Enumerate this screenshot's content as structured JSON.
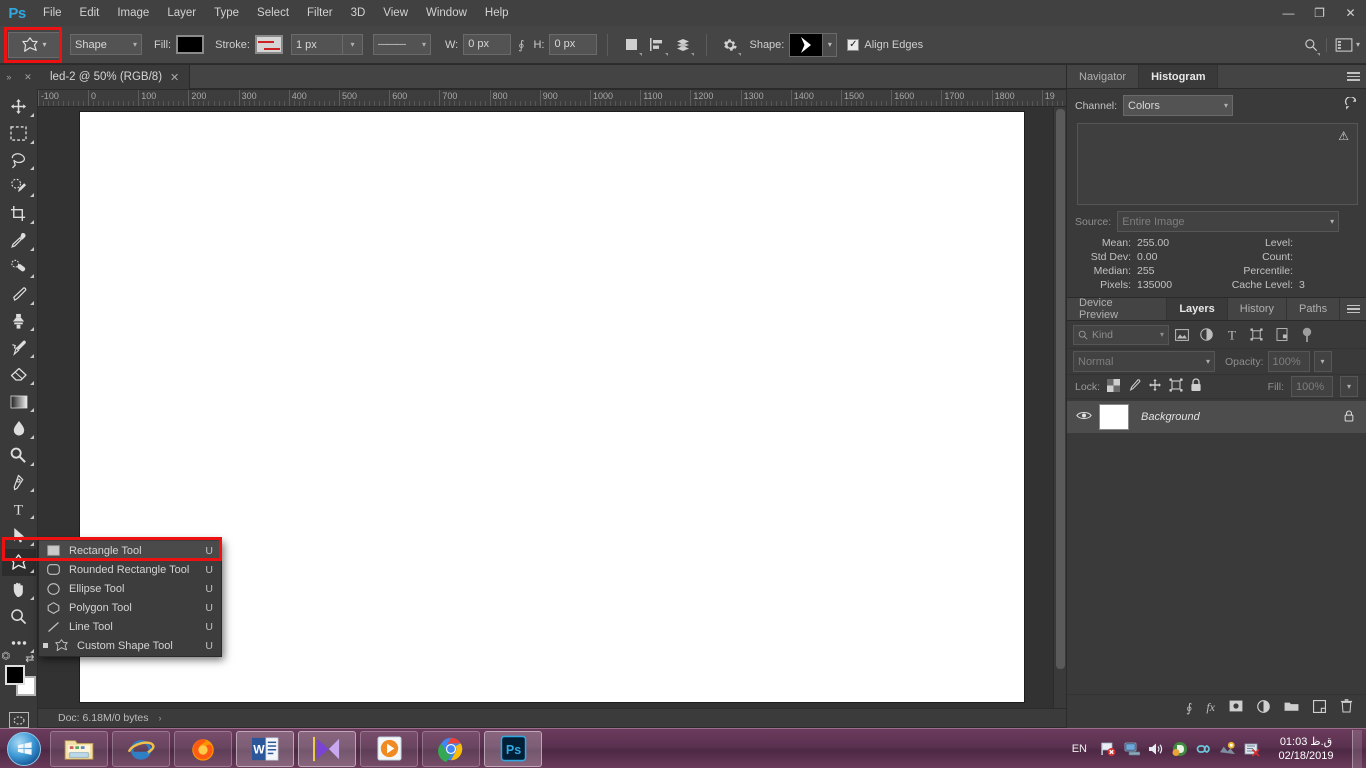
{
  "app": {
    "name": "Adobe Photoshop",
    "logo_text": "Ps"
  },
  "menubar": {
    "items": [
      {
        "label": "File"
      },
      {
        "label": "Edit"
      },
      {
        "label": "Image"
      },
      {
        "label": "Layer"
      },
      {
        "label": "Type"
      },
      {
        "label": "Select"
      },
      {
        "label": "Filter"
      },
      {
        "label": "3D"
      },
      {
        "label": "View"
      },
      {
        "label": "Window"
      },
      {
        "label": "Help"
      }
    ],
    "window_controls": {
      "minimize": "—",
      "restore": "❐",
      "close": "✕"
    }
  },
  "options_bar": {
    "tool_preset_name": "custom-shape-tool",
    "mode_label": "",
    "mode_value": "Shape",
    "fill_label": "Fill:",
    "fill_color": "#000000",
    "stroke_label": "Stroke:",
    "stroke_color": "#d5d5d5",
    "stroke_width": "1 px",
    "stroke_style": "———",
    "w_label": "W:",
    "w_value": "0 px",
    "link_icon": "link-icon",
    "h_label": "H:",
    "h_value": "0 px",
    "path_ops_icon": "path-operations-icon",
    "path_align_icon": "path-alignment-icon",
    "path_arrange_icon": "path-arrangement-icon",
    "gear_icon": "gear-icon",
    "shape_label": "Shape:",
    "shape_preview": "arrow-chevron-shape",
    "align_edges_label": "Align Edges",
    "align_edges_checked": true,
    "search_icon": "search-icon",
    "workspace_icon": "workspace-switcher-icon"
  },
  "document": {
    "tab_title": "led-2 @ 50% (RGB/8)",
    "tab_close": "✕",
    "zoom": "50%",
    "color_mode": "RGB/8",
    "status": "Doc: 6.18M/0 bytes",
    "status_arrow": "›",
    "ruler_ticks": [
      "-100",
      "0",
      "100",
      "200",
      "300",
      "400",
      "500",
      "600",
      "700",
      "800",
      "900",
      "1000",
      "1100",
      "1200",
      "1300",
      "1400",
      "1500",
      "1600",
      "1700",
      "1800",
      "19"
    ],
    "canvas_color": "#ffffff"
  },
  "toolbox": {
    "collapse_icon": "»",
    "close_icon": "✕",
    "tools": [
      {
        "name": "move-tool",
        "more": true
      },
      {
        "name": "rectangular-marquee-tool",
        "more": true
      },
      {
        "name": "lasso-tool",
        "more": true
      },
      {
        "name": "quick-selection-tool",
        "more": true
      },
      {
        "name": "crop-tool",
        "more": true
      },
      {
        "name": "eyedropper-tool",
        "more": true
      },
      {
        "name": "spot-healing-brush-tool",
        "more": true
      },
      {
        "name": "brush-tool",
        "more": true
      },
      {
        "name": "clone-stamp-tool",
        "more": true
      },
      {
        "name": "history-brush-tool",
        "more": true
      },
      {
        "name": "eraser-tool",
        "more": true
      },
      {
        "name": "gradient-tool",
        "more": true
      },
      {
        "name": "blur-tool",
        "more": true
      },
      {
        "name": "dodge-tool",
        "more": true
      },
      {
        "name": "pen-tool",
        "more": true
      },
      {
        "name": "type-tool",
        "more": true
      },
      {
        "name": "path-selection-tool",
        "more": true
      },
      {
        "name": "shape-tool",
        "more": true,
        "active": true
      },
      {
        "name": "hand-tool",
        "more": true
      },
      {
        "name": "zoom-tool",
        "more": false
      },
      {
        "name": "edit-toolbar-tool",
        "more": true
      }
    ],
    "foreground_color": "#000000",
    "background_color": "#ffffff",
    "quick_mask_icon": "quick-mask-icon"
  },
  "flyout_menu": {
    "items": [
      {
        "label": "Rectangle Tool",
        "shortcut": "U",
        "icon": "rectangle-icon",
        "selected": true,
        "checked": false
      },
      {
        "label": "Rounded Rectangle Tool",
        "shortcut": "U",
        "icon": "rounded-rectangle-icon",
        "selected": false,
        "checked": false
      },
      {
        "label": "Ellipse Tool",
        "shortcut": "U",
        "icon": "ellipse-icon",
        "selected": false,
        "checked": false
      },
      {
        "label": "Polygon Tool",
        "shortcut": "U",
        "icon": "polygon-icon",
        "selected": false,
        "checked": false
      },
      {
        "label": "Line Tool",
        "shortcut": "U",
        "icon": "line-icon",
        "selected": false,
        "checked": false
      },
      {
        "label": "Custom Shape Tool",
        "shortcut": "U",
        "icon": "custom-shape-icon",
        "selected": false,
        "checked": true
      }
    ]
  },
  "histogram_panel": {
    "tabs": [
      {
        "label": "Navigator",
        "active": false
      },
      {
        "label": "Histogram",
        "active": true
      }
    ],
    "channel_label": "Channel:",
    "channel_value": "Colors",
    "refresh_icon": "refresh-icon",
    "warning_icon": "warning-icon",
    "source_label": "Source:",
    "source_value": "Entire Image",
    "stats": [
      {
        "label": "Mean:",
        "value": "255.00",
        "label2": "Level:",
        "value2": ""
      },
      {
        "label": "Std Dev:",
        "value": "0.00",
        "label2": "Count:",
        "value2": ""
      },
      {
        "label": "Median:",
        "value": "255",
        "label2": "Percentile:",
        "value2": ""
      },
      {
        "label": "Pixels:",
        "value": "135000",
        "label2": "Cache Level:",
        "value2": "3"
      }
    ]
  },
  "layers_panel": {
    "tabs": [
      {
        "label": "Device Preview",
        "active": false
      },
      {
        "label": "Layers",
        "active": true
      },
      {
        "label": "History",
        "active": false
      },
      {
        "label": "Paths",
        "active": false
      }
    ],
    "filter_kind_label": "Kind",
    "filter_icons": [
      "pixel-filter-icon",
      "adjustment-filter-icon",
      "type-filter-icon",
      "shape-filter-icon",
      "smart-object-filter-icon",
      "filter-toggle-icon"
    ],
    "blend_mode": "Normal",
    "opacity_label": "Opacity:",
    "opacity_value": "100%",
    "lock_label": "Lock:",
    "lock_icons": [
      "lock-transparent-pixels-icon",
      "lock-image-pixels-icon",
      "lock-position-icon",
      "lock-artboard-icon",
      "lock-all-icon"
    ],
    "fill_label": "Fill:",
    "fill_value": "100%",
    "layers": [
      {
        "name": "Background",
        "visible": true,
        "locked": true,
        "thumb_color": "#ffffff"
      }
    ],
    "bottom_icons": [
      "link-layers-icon",
      "layer-style-fx-icon",
      "add-layer-mask-icon",
      "new-adjustment-layer-icon",
      "new-group-icon",
      "new-layer-icon",
      "delete-layer-icon"
    ],
    "fx_label": "fx"
  },
  "taskbar": {
    "start_label": "start-orb",
    "items": [
      {
        "name": "windows-explorer-icon",
        "running": false
      },
      {
        "name": "internet-explorer-icon",
        "running": false
      },
      {
        "name": "firefox-icon",
        "running": false
      },
      {
        "name": "microsoft-word-icon",
        "running": true
      },
      {
        "name": "media-player-classic-icon",
        "running": true
      },
      {
        "name": "vlc-media-player-icon",
        "running": false
      },
      {
        "name": "google-chrome-icon",
        "running": false
      },
      {
        "name": "photoshop-icon",
        "running": true
      }
    ],
    "tray": {
      "language": "EN",
      "icons": [
        "action-center-flag-icon",
        "network-icon",
        "volume-icon",
        "internet-download-manager-icon",
        "link-icon",
        "update-icon",
        "antivirus-icon"
      ],
      "clock_time": "01:03 ق.ظ",
      "clock_date": "02/18/2019"
    }
  },
  "annotations": {
    "highlight_color": "#ee1111",
    "boxes": [
      {
        "name": "tool-preset-highlight"
      },
      {
        "name": "rectangle-tool-menu-item-highlight"
      }
    ]
  }
}
